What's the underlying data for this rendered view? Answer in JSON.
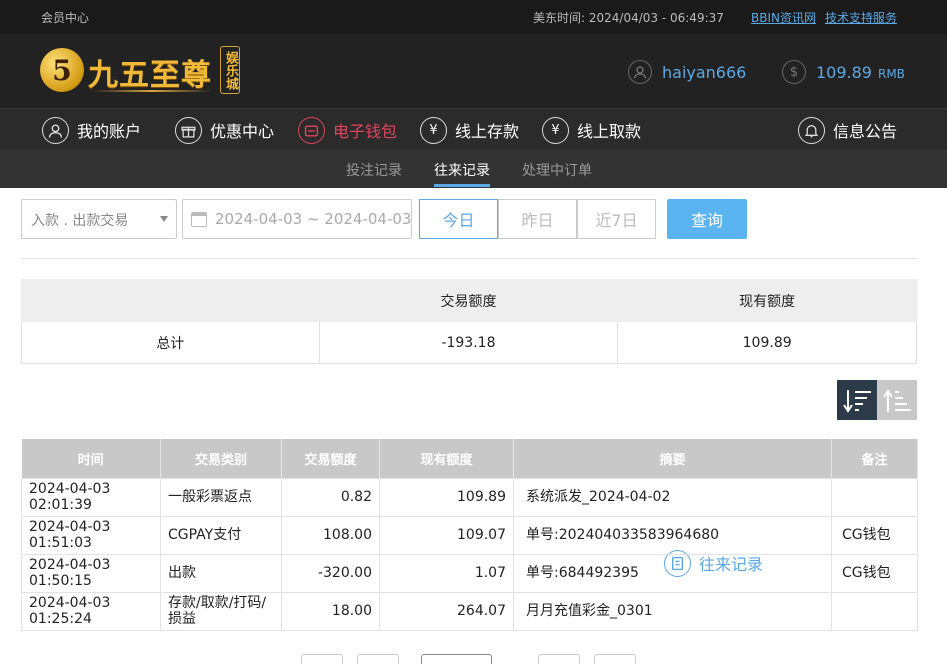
{
  "topbar": {
    "member_center": "会员中心",
    "time_label": "美东时间:",
    "time_value": "2024/04/03 - 06:49:37",
    "bbin_link": "BBIN资讯网",
    "support_link": "技术支持服务"
  },
  "header": {
    "logo_text": "九五至尊",
    "logo_badge": "娱乐城",
    "username": "haiyan666",
    "balance": "109.89",
    "currency": "RMB"
  },
  "nav": {
    "items": [
      {
        "label": "我的账户",
        "icon": "user-icon"
      },
      {
        "label": "优惠中心",
        "icon": "gift-icon"
      },
      {
        "label": "电子钱包",
        "icon": "wallet-icon"
      },
      {
        "label": "线上存款",
        "icon": "deposit-icon"
      },
      {
        "label": "线上取款",
        "icon": "withdraw-icon"
      },
      {
        "label": "往来记录",
        "icon": "records-icon"
      },
      {
        "label": "信息公告",
        "icon": "bell-icon"
      }
    ],
    "active_index": 5,
    "highlight_color": "#e3445e",
    "accent_color": "#5aa9e6"
  },
  "subnav": {
    "tabs": [
      "投注记录",
      "往来记录",
      "处理中订单"
    ],
    "active_index": 1
  },
  "filters": {
    "type_value": "入款 . 出款交易",
    "date_range": "2024-04-03 ~ 2024-04-03",
    "quick_days": [
      "今日",
      "昨日",
      "近7日"
    ],
    "active_day": 0,
    "query_label": "查询"
  },
  "summary": {
    "headers": [
      "",
      "交易额度",
      "现有额度"
    ],
    "row": [
      "总计",
      "-193.18",
      "109.89"
    ]
  },
  "records": {
    "headers": [
      "时间",
      "交易类别",
      "交易额度",
      "现有额度",
      "摘要",
      "备注"
    ],
    "rows": [
      [
        "2024-04-03 02:01:39",
        "一般彩票返点",
        "0.82",
        "109.89",
        "系统派发_2024-04-02",
        ""
      ],
      [
        "2024-04-03 01:51:03",
        "CGPAY支付",
        "108.00",
        "109.07",
        "单号:202404033583964680",
        "CG钱包"
      ],
      [
        "2024-04-03 01:50:15",
        "出款",
        "-320.00",
        "1.07",
        "单号:684492395",
        "CG钱包"
      ],
      [
        "2024-04-03 01:25:24",
        "存款/取款/打码/损益",
        "18.00",
        "264.07",
        "月月充值彩金_0301",
        ""
      ]
    ]
  }
}
